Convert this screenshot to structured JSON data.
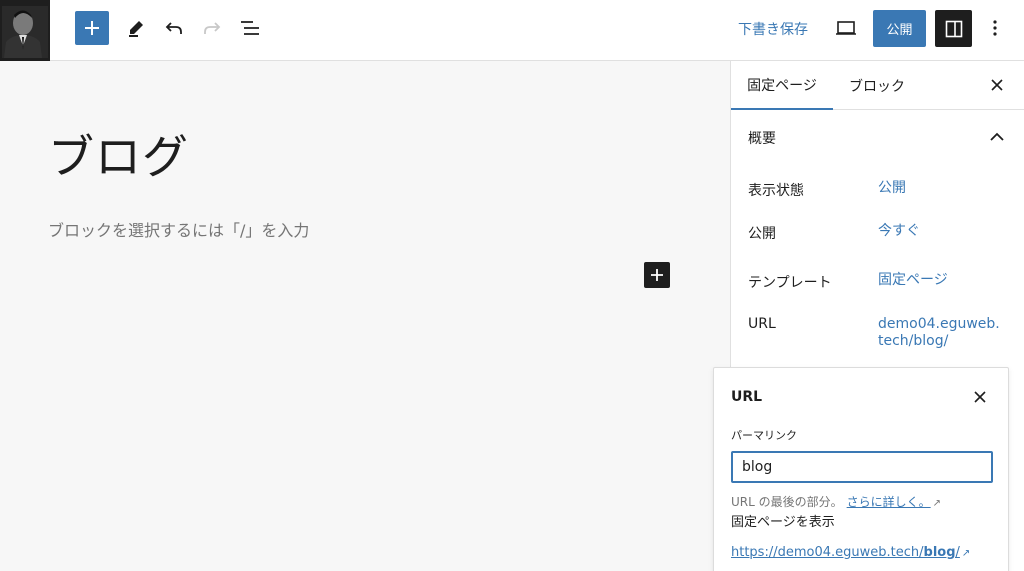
{
  "toolbar": {
    "add_block_icon": "plus-icon",
    "tools_icon": "pencil-icon",
    "undo_icon": "undo-icon",
    "redo_icon": "redo-icon",
    "list_view_icon": "list-view-icon",
    "save_draft_label": "下書き保存",
    "preview_icon": "laptop-icon",
    "publish_label": "公開",
    "settings_icon": "sidebar-icon",
    "more_icon": "vertical-ellipsis-icon"
  },
  "editor": {
    "title": "ブログ",
    "placeholder": "ブロックを選択するには「/」を入力"
  },
  "sidebar": {
    "tab_page": "固定ページ",
    "tab_block": "ブロック",
    "summary_title": "概要",
    "rows": [
      {
        "label": "表示状態",
        "value": "公開"
      },
      {
        "label": "公開",
        "value": "今すぐ"
      },
      {
        "label": "テンプレート",
        "value": "固定ページ"
      },
      {
        "label": "URL",
        "value": "demo04.eguweb.tech/blog/"
      }
    ]
  },
  "url_popover": {
    "title": "URL",
    "permalink_label": "パーマリンク",
    "slug_value": "blog",
    "help_text": "URL の最後の部分。",
    "help_link": "さらに詳しく。",
    "view_label": "固定ページを表示",
    "link_prefix": "https://demo04.eguweb.tech/",
    "link_slug": "blog",
    "link_suffix": "/"
  },
  "colors": {
    "accent": "#3a78b4",
    "dark": "#1e1e1e",
    "muted": "#757575"
  }
}
